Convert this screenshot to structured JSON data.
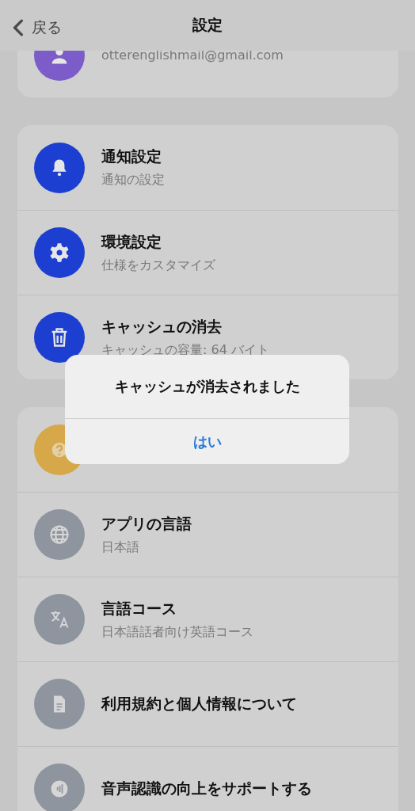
{
  "header": {
    "back": "戻る",
    "title": "設定"
  },
  "sections": [
    {
      "items": [
        {
          "color": "#7b5cc8",
          "subtitle": "otterenglishmail@gmail.com"
        }
      ]
    },
    {
      "items": [
        {
          "color": "#1c3fd2",
          "title": "通知設定",
          "subtitle": "通知の設定"
        },
        {
          "color": "#1c3fd2",
          "title": "環境設定",
          "subtitle": "仕様をカスタマイズ"
        },
        {
          "color": "#1c3fd2",
          "title": "キャッシュの消去",
          "subtitle": "キャッシュの容量: 64 バイト"
        }
      ]
    },
    {
      "items": [
        {
          "color": "#d6a84a"
        },
        {
          "color": "#8e959e",
          "title": "アプリの言語",
          "subtitle": "日本語"
        },
        {
          "color": "#8e959e",
          "title": "言語コース",
          "subtitle": "日本語話者向け英語コース"
        },
        {
          "color": "#8e959e",
          "title": "利用規約と個人情報について"
        },
        {
          "color": "#8e959e",
          "title": "音声認識の向上をサポートする"
        }
      ]
    }
  ],
  "dialog": {
    "message": "キャッシュが消去されました",
    "button": "はい"
  }
}
